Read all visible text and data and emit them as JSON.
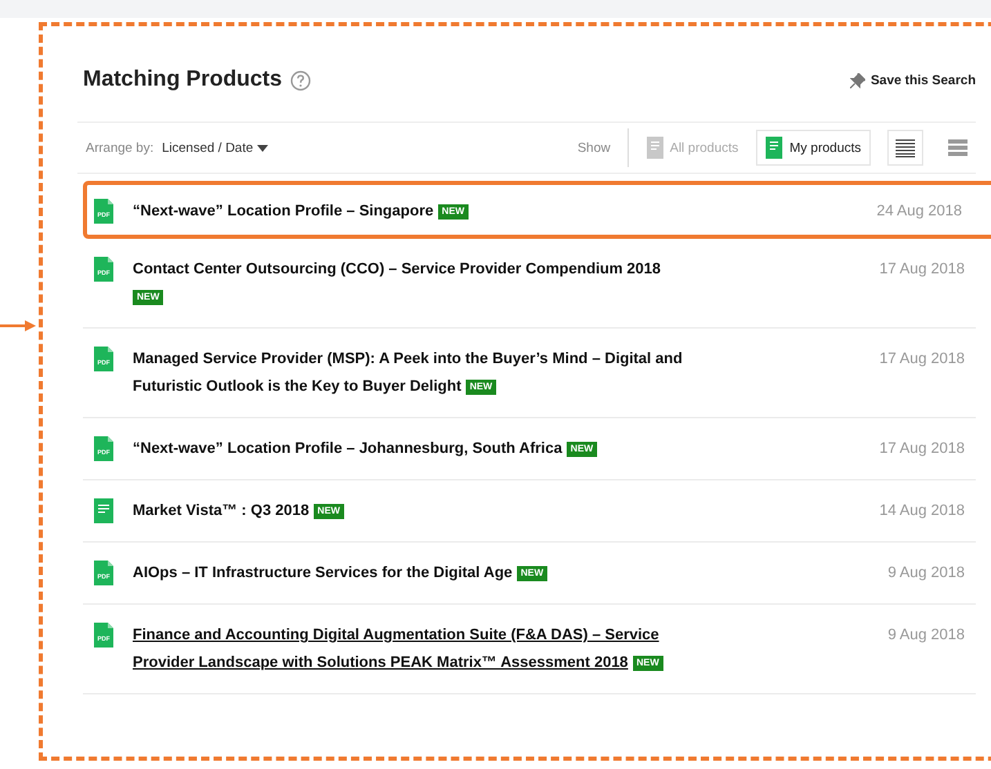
{
  "header": {
    "title": "Matching Products",
    "save_search": "Save this Search"
  },
  "toolbar": {
    "arrange_label": "Arrange by:",
    "arrange_value": "Licensed / Date",
    "show_label": "Show",
    "filters": [
      {
        "label": "All products",
        "selected": false
      },
      {
        "label": "My products",
        "selected": true
      }
    ],
    "views": [
      {
        "kind": "compact",
        "selected": true
      },
      {
        "kind": "comfortable",
        "selected": false
      }
    ]
  },
  "items": [
    {
      "kind": "pdf",
      "icon_label": "PDF",
      "title": "“Next-wave” Location Profile – Singapore",
      "badge": "NEW",
      "date": "24 Aug 2018",
      "selected": true,
      "hovered": false
    },
    {
      "kind": "pdf",
      "icon_label": "PDF",
      "title": "Contact Center Outsourcing (CCO) – Service Provider Compendium 2018",
      "badge": "NEW",
      "date": "17 Aug 2018",
      "selected": false,
      "hovered": false
    },
    {
      "kind": "pdf",
      "icon_label": "PDF",
      "title": "Managed Service Provider (MSP): A Peek into the Buyer’s Mind – Digital and Futuristic Outlook is the Key to Buyer Delight",
      "badge": "NEW",
      "date": "17 Aug 2018",
      "selected": false,
      "hovered": false
    },
    {
      "kind": "pdf",
      "icon_label": "PDF",
      "title": "“Next-wave” Location Profile – Johannesburg, South Africa",
      "badge": "NEW",
      "date": "17 Aug 2018",
      "selected": false,
      "hovered": false
    },
    {
      "kind": "doc",
      "title": "Market Vista™ : Q3 2018",
      "badge": "NEW",
      "date": "14 Aug 2018",
      "selected": false,
      "hovered": false
    },
    {
      "kind": "pdf",
      "icon_label": "PDF",
      "title": "AIOps – IT Infrastructure Services for the Digital Age",
      "badge": "NEW",
      "date": "9 Aug 2018",
      "selected": false,
      "hovered": false
    },
    {
      "kind": "pdf",
      "icon_label": "PDF",
      "title": "Finance and Accounting Digital Augmentation Suite (F&A DAS) – Service Provider Landscape with Solutions PEAK Matrix™ Assessment 2018",
      "badge": "NEW",
      "date": "9 Aug 2018",
      "selected": false,
      "hovered": true
    }
  ]
}
